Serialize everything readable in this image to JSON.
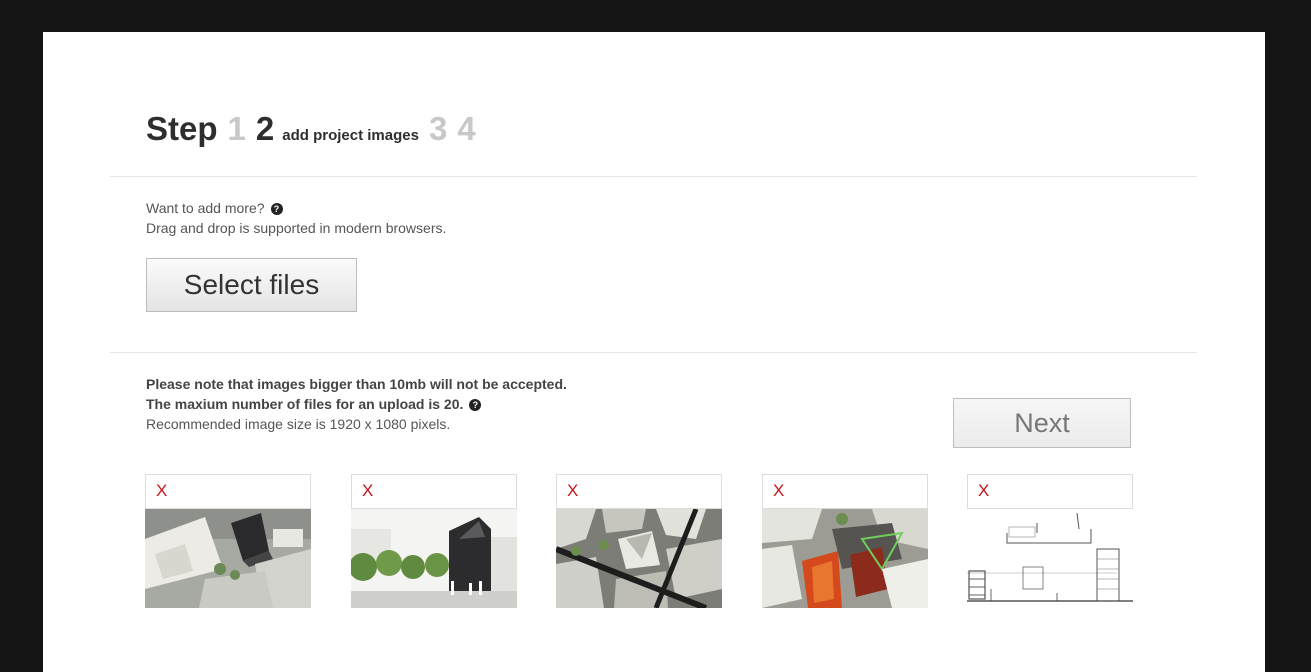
{
  "steps": {
    "label": "Step",
    "items": [
      {
        "num": "1",
        "active": false
      },
      {
        "num": "2",
        "active": true,
        "description": "add project images"
      },
      {
        "num": "3",
        "active": false
      },
      {
        "num": "4",
        "active": false
      }
    ]
  },
  "upload": {
    "prompt": "Want to add more?",
    "help_glyph": "?",
    "drag_note": "Drag and drop is supported in modern browsers.",
    "select_label": "Select files"
  },
  "notes": {
    "size_limit": "Please note that images bigger than 10mb will not be accepted.",
    "max_files": "The maxium number of files for an upload is 20.",
    "recommended": "Recommended image size is 1920 x 1080 pixels."
  },
  "next_label": "Next",
  "thumbnails": [
    {
      "remove_label": "X",
      "image": "aerial rendering with dark angular building"
    },
    {
      "remove_label": "X",
      "image": "street view of dark building with trees"
    },
    {
      "remove_label": "X",
      "image": "top-down aerial view of city blocks"
    },
    {
      "remove_label": "X",
      "image": "aerial rendering with orange and red structure"
    },
    {
      "remove_label": "X",
      "image": "architectural section drawing"
    }
  ],
  "colors": {
    "background": "#151415",
    "remove": "#c4161c",
    "inactive_step": "#c8c8c8"
  }
}
